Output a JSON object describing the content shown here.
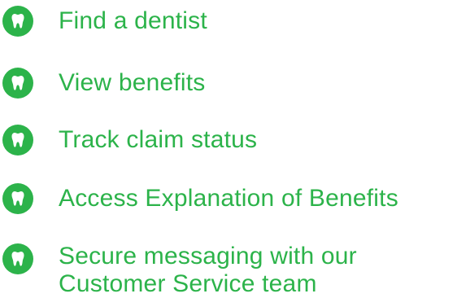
{
  "colors": {
    "accent": "#2cb34a",
    "icon_fill": "#2cb34a",
    "icon_glyph": "#ffffff"
  },
  "links": [
    {
      "icon": "tooth-icon",
      "lines": [
        "Find a dentist"
      ]
    },
    {
      "icon": "tooth-icon",
      "lines": [
        "View benefits"
      ]
    },
    {
      "icon": "tooth-icon",
      "lines": [
        "Track claim status"
      ]
    },
    {
      "icon": "tooth-icon",
      "lines": [
        "Access Explanation of Benefits"
      ]
    },
    {
      "icon": "tooth-icon",
      "lines": [
        "Secure messaging with our",
        "Customer Service team"
      ]
    }
  ]
}
